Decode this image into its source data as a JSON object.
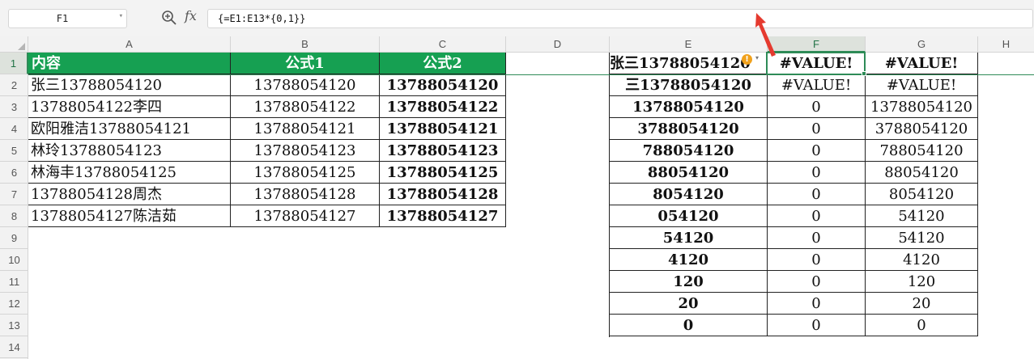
{
  "formula_bar": {
    "name_box": "F1",
    "fx_label": "fx",
    "formula": "{=E1:E13*{0,1}}"
  },
  "columns": [
    "A",
    "B",
    "C",
    "D",
    "E",
    "F",
    "G",
    "H"
  ],
  "rows": [
    "1",
    "2",
    "3",
    "4",
    "5",
    "6",
    "7",
    "8",
    "9",
    "10",
    "11",
    "12",
    "13",
    "14"
  ],
  "table_left": {
    "headers": [
      "内容",
      "公式1",
      "公式2"
    ],
    "rows": [
      [
        "张三13788054120",
        "13788054120",
        "13788054120"
      ],
      [
        "13788054122李四",
        "13788054122",
        "13788054122"
      ],
      [
        "欧阳雅洁13788054121",
        "13788054121",
        "13788054121"
      ],
      [
        "林玲13788054123",
        "13788054123",
        "13788054123"
      ],
      [
        "林海丰13788054125",
        "13788054125",
        "13788054125"
      ],
      [
        "13788054128周杰",
        "13788054128",
        "13788054128"
      ],
      [
        "13788054127陈洁茹",
        "13788054127",
        "13788054127"
      ]
    ]
  },
  "table_right": {
    "rows": [
      [
        "张三13788054120",
        "#VALUE!",
        "#VALUE!"
      ],
      [
        "三13788054120",
        "#VALUE!",
        "#VALUE!"
      ],
      [
        "13788054120",
        "0",
        "13788054120"
      ],
      [
        "3788054120",
        "0",
        "3788054120"
      ],
      [
        "788054120",
        "0",
        "788054120"
      ],
      [
        "88054120",
        "0",
        "88054120"
      ],
      [
        "8054120",
        "0",
        "8054120"
      ],
      [
        "054120",
        "0",
        "54120"
      ],
      [
        "54120",
        "0",
        "54120"
      ],
      [
        "4120",
        "0",
        "4120"
      ],
      [
        "120",
        "0",
        "120"
      ],
      [
        "20",
        "0",
        "20"
      ],
      [
        "0",
        "0",
        "0"
      ]
    ]
  },
  "warning_badge": "!",
  "colors": {
    "header_green": "#16a052",
    "selection": "#2e8b57",
    "annotation_arrow": "#e53a2f"
  }
}
